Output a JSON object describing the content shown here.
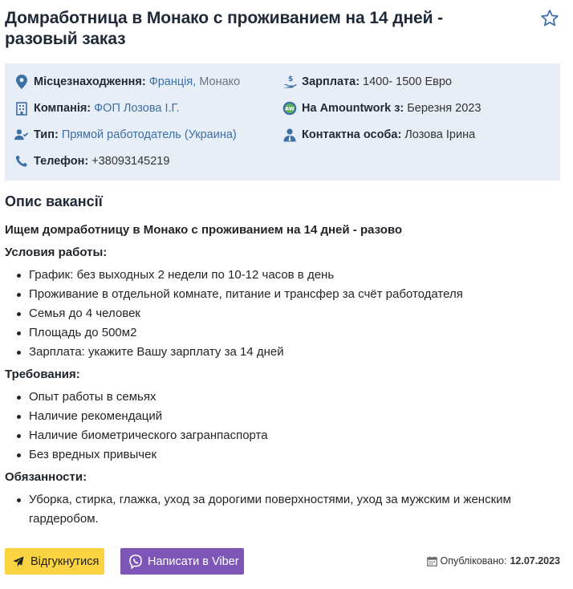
{
  "job": {
    "title": "Домработница в Монако с проживанием на 14 дней - разовый заказ"
  },
  "info": {
    "location_label": "Місцезнаходження:",
    "location_country": "Франція,",
    "location_city": "Монако",
    "salary_label": "Зарплата:",
    "salary_value": "1400- 1500 Евро",
    "company_label": "Компанія:",
    "company_value": "ФОП Лозова І.Г.",
    "since_label": "На Amountwork з:",
    "since_value": "Березня 2023",
    "type_label": "Тип:",
    "type_value": "Прямой работодатель (Украина)",
    "contact_label": "Контактна особа:",
    "contact_value": "Лозова Ірина",
    "phone_label": "Телефон:",
    "phone_value": "+38093145219"
  },
  "description": {
    "section_title": "Опис вакансії",
    "intro": "Ищем домработницу в Монако с проживанием на 14 дней - разово",
    "conditions_title": "Условия работы:",
    "conditions": [
      "График: без выходных 2 недели по 10-12 часов в день",
      "Проживание в отдельной комнате, питание и трансфер за счёт работодателя",
      "Семья до 4 человек",
      "Площадь до 500м2",
      "Зарплата: укажите Вашу зарплату за 14 дней"
    ],
    "requirements_title": "Требования:",
    "requirements": [
      "Опыт работы в семьях",
      "Наличие рекомендаций",
      "Наличие биометрического загранпаспорта",
      "Без вредных привычек"
    ],
    "duties_title": "Обязанности:",
    "duties": [
      "Уборка, стирка, глажка, уход за дорогими поверхностями, уход за мужским и женским гардеробом."
    ]
  },
  "actions": {
    "respond_label": "Відгукнутися",
    "viber_label": "Написати в Viber"
  },
  "published": {
    "label": "Опубліковано:",
    "date": "12.07.2023"
  },
  "colors": {
    "accent_blue": "#3b6fa8",
    "info_bg": "#e8eef5",
    "yellow_button": "#f9d342",
    "viber_purple": "#7d56b8"
  }
}
